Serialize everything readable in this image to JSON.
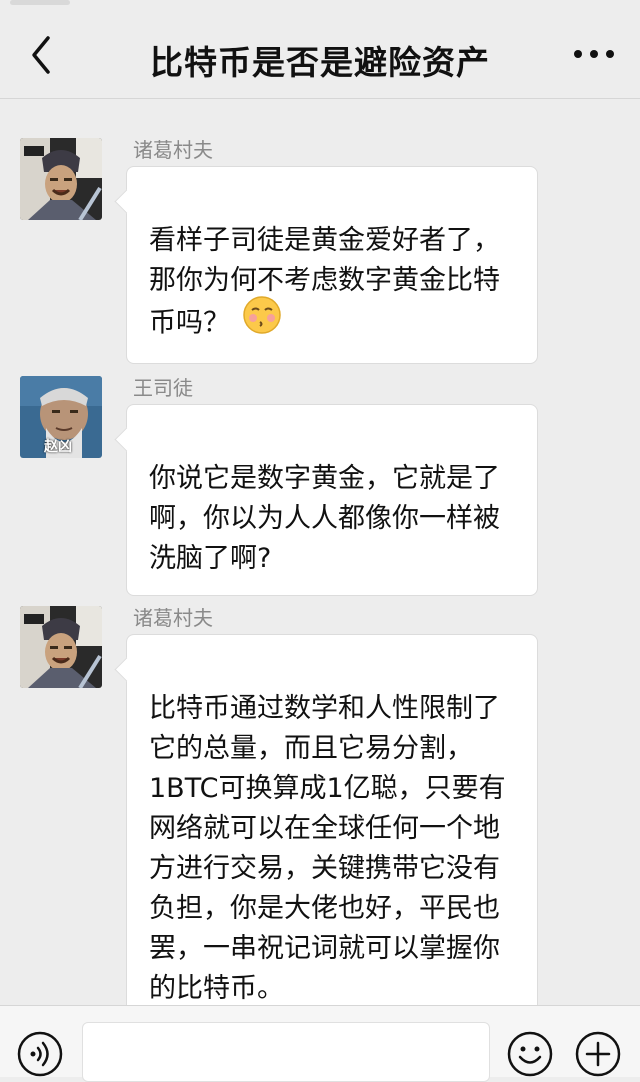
{
  "header": {
    "title": "比特币是否是避险资产",
    "back_icon": "chevron-left-icon",
    "more_icon": "more-dots-icon"
  },
  "messages": [
    {
      "sender": "诸葛村夫",
      "avatar": "zhuge-avatar",
      "text": "看样子司徒是黄金爱好者了，\n那你为何不考虑数字黄金比特\n币吗？",
      "emoji": "blushing-face-emoji"
    },
    {
      "sender": "王司徒",
      "avatar": "wang-situ-avatar",
      "avatar_caption": "赵凶",
      "text": "你说它是数字黄金，它就是了\n啊，你以为人人都像你一样被\n洗脑了啊?"
    },
    {
      "sender": "诸葛村夫",
      "avatar": "zhuge-avatar",
      "text": "比特币通过数学和人性限制了\n它的总量，而且它易分割，\n1BTC可换算成1亿聪，只要有\n网络就可以在全球任何一个地\n方进行交易，关键携带它没有\n负担，你是大佬也好，平民也\n罢，一串祝记词就可以掌握你\n的比特币。"
    }
  ],
  "input_bar": {
    "voice_icon": "voice-icon",
    "emoji_icon": "emoji-icon",
    "plus_icon": "plus-icon",
    "input_value": ""
  }
}
